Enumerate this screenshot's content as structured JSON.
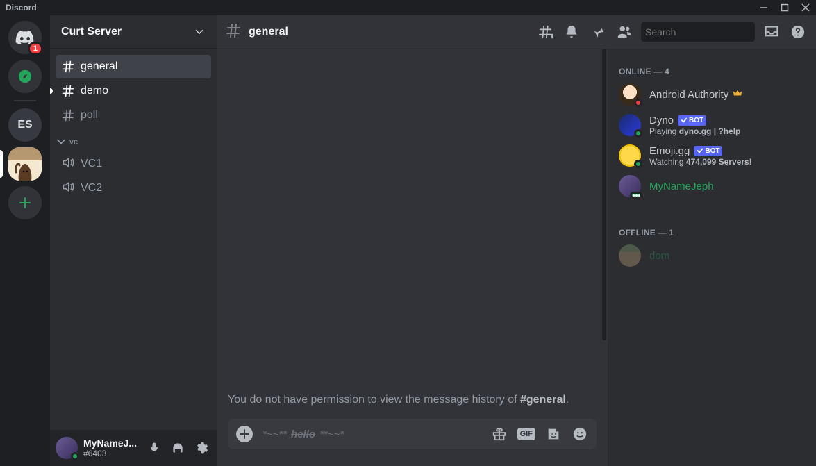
{
  "app_title": "Discord",
  "server_name": "Curt Server",
  "home_ping": "1",
  "servers": {
    "es_label": "ES"
  },
  "channels": {
    "text": [
      {
        "name": "general",
        "active": true
      },
      {
        "name": "demo",
        "unread": true
      },
      {
        "name": "poll"
      }
    ],
    "voice_category": "vc",
    "voice": [
      {
        "name": "VC1"
      },
      {
        "name": "VC2"
      }
    ]
  },
  "user": {
    "display": "MyNameJ...",
    "tag": "#6403"
  },
  "header": {
    "channel": "general",
    "search_placeholder": "Search"
  },
  "chat": {
    "perm_prefix": "You do not have permission to view the message history of ",
    "perm_channel": "#general",
    "perm_suffix": ".",
    "composer_left": "*~~**",
    "composer_mid": "hello",
    "composer_right": "**~~*"
  },
  "members": {
    "online_label": "ONLINE — 4",
    "offline_label": "OFFLINE — 1",
    "online": [
      {
        "name": "Android Authority",
        "crown": true,
        "status_color": "dnd"
      },
      {
        "name": "Dyno",
        "bot": true,
        "activity_prefix": "Playing ",
        "activity_bold": "dyno.gg | ?help",
        "status_color": "online"
      },
      {
        "name": "Emoji.gg",
        "bot": true,
        "activity_prefix": "Watching ",
        "activity_bold": "474,099 Servers!",
        "status_color": "online"
      },
      {
        "name": "MyNameJeph",
        "green": true,
        "status_color": "online",
        "typing": true
      }
    ],
    "offline": [
      {
        "name": "dom",
        "green": true
      }
    ],
    "bot_label": "BOT"
  }
}
